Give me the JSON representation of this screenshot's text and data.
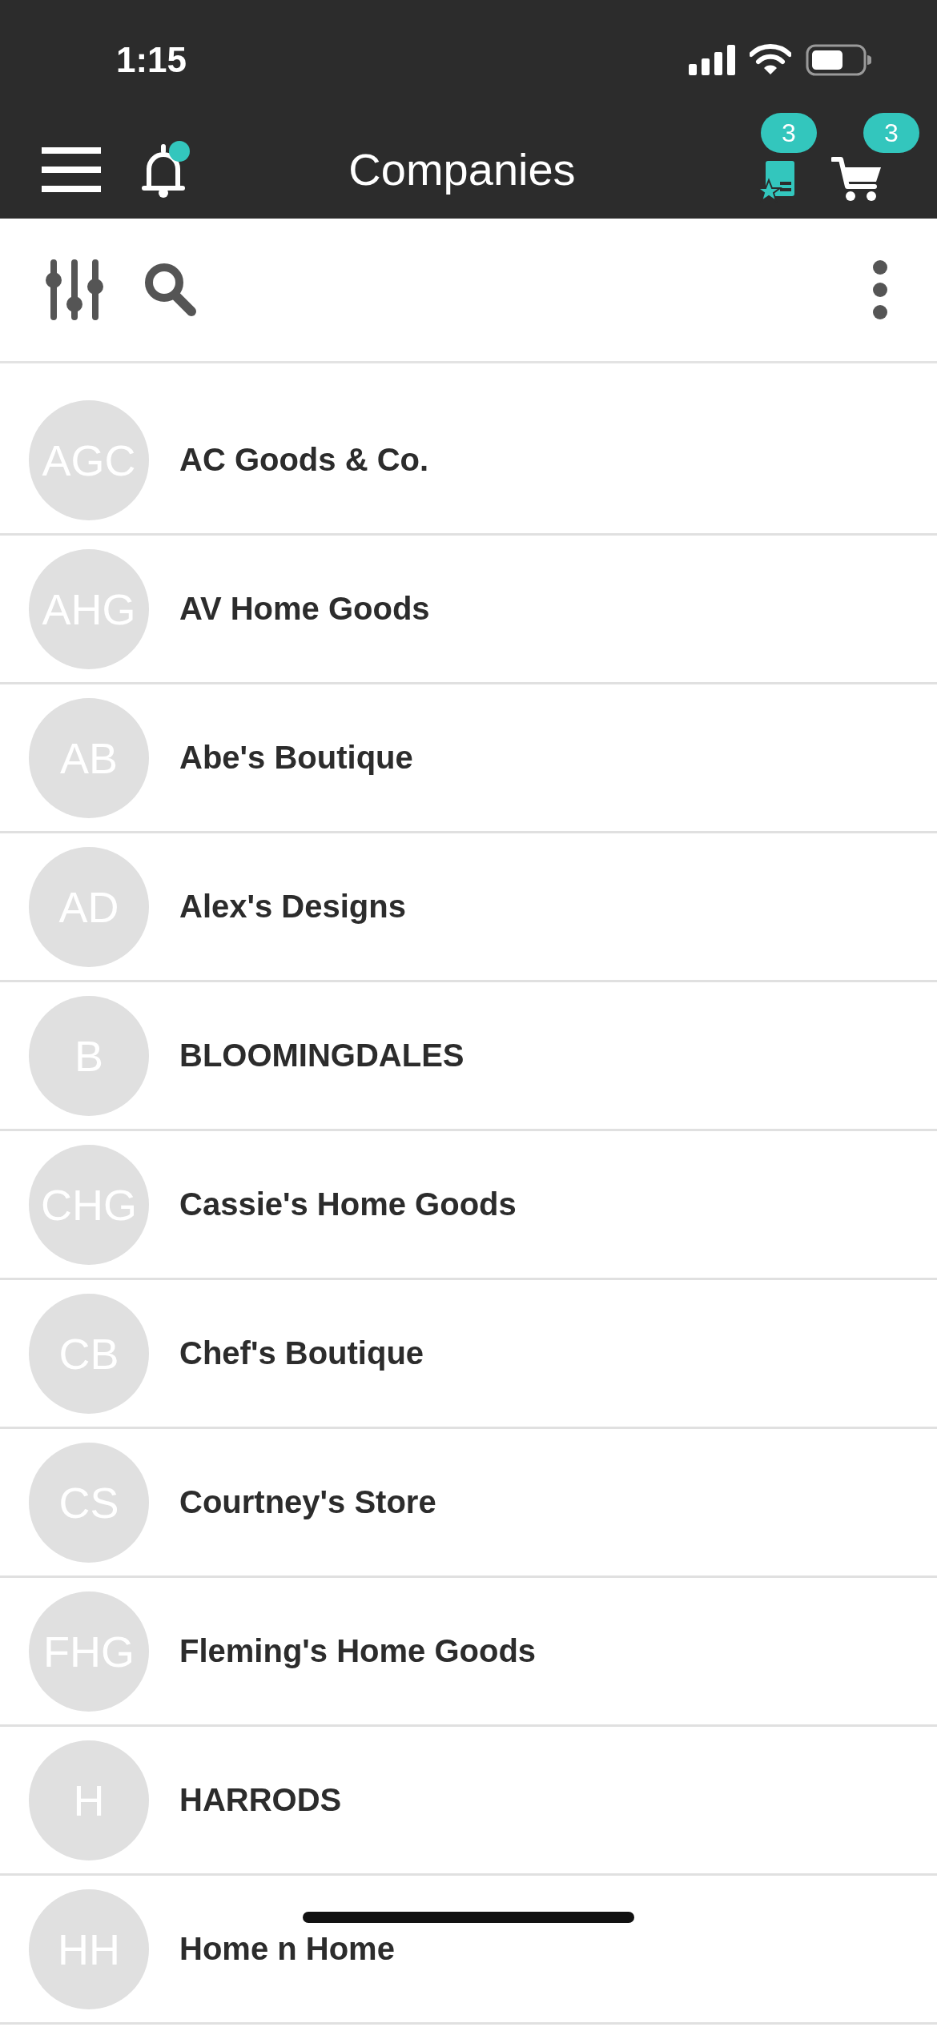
{
  "status_bar": {
    "time": "1:15"
  },
  "header": {
    "title": "Companies",
    "notifications_unread": true,
    "favorites_badge": "3",
    "cart_badge": "3"
  },
  "companies": [
    {
      "initials": "AGC",
      "name": "AC Goods & Co."
    },
    {
      "initials": "AHG",
      "name": "AV Home Goods"
    },
    {
      "initials": "AB",
      "name": "Abe's Boutique"
    },
    {
      "initials": "AD",
      "name": "Alex's Designs"
    },
    {
      "initials": "B",
      "name": "BLOOMINGDALES"
    },
    {
      "initials": "CHG",
      "name": "Cassie's Home Goods"
    },
    {
      "initials": "CB",
      "name": "Chef's Boutique"
    },
    {
      "initials": "CS",
      "name": "Courtney's Store"
    },
    {
      "initials": "FHG",
      "name": "Fleming's Home Goods"
    },
    {
      "initials": "H",
      "name": "HARRODS"
    },
    {
      "initials": "HH",
      "name": "Home n Home"
    }
  ]
}
